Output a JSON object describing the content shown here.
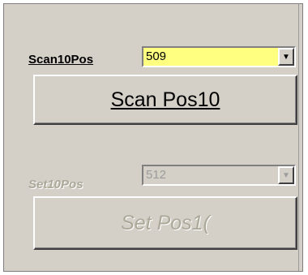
{
  "scan": {
    "label": "Scan10Pos",
    "combo_value": "509",
    "button_label": "Scan Pos10"
  },
  "set": {
    "label": "Set10Pos",
    "combo_value": "512",
    "button_label": "Set Pos1("
  },
  "icons": {
    "dropdown": "chevron-down-icon"
  },
  "colors": {
    "panel_bg": "#d4d0c8",
    "combo_active_bg": "#ffff80",
    "disabled_text": "#aca899"
  }
}
